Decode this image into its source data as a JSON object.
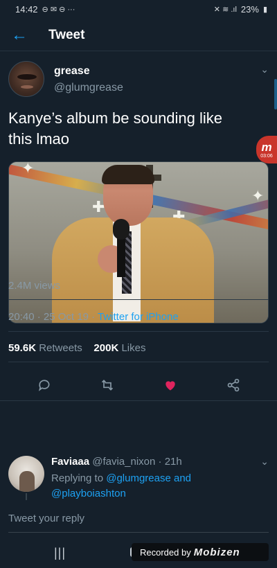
{
  "status_bar": {
    "time": "14:42",
    "battery": "23%"
  },
  "header": {
    "back_icon": "arrow-left-icon",
    "title": "Tweet"
  },
  "tweet": {
    "author_name": "grease",
    "author_handle": "@glumgrease",
    "text_line1": "Kanye’s album be sounding like",
    "text_line2": "this lmao",
    "views": "2.4M views",
    "time": "20:40",
    "date": "25 Oct 19",
    "source": "Twitter for iPhone",
    "retweets_count": "59.6K",
    "retweets_label": "Retweets",
    "likes_count": "200K",
    "likes_label": "Likes"
  },
  "actions": {
    "reply_icon": "comment-icon",
    "retweet_icon": "retweet-icon",
    "like_icon": "heart-icon",
    "share_icon": "share-icon",
    "like_color": "#e0245e"
  },
  "reply": {
    "author_name": "Faviaaa",
    "author_handle": "@favia_nixon",
    "time": "21h",
    "replying_to_label": "Replying to",
    "mention1": "@glumgrease",
    "and_label": "and",
    "mention2": "@playboiashton"
  },
  "compose": {
    "placeholder": "Tweet your reply"
  },
  "overlay": {
    "side_badge_letter": "m",
    "side_badge_time": "03:06",
    "recorded_label": "Recorded by",
    "brand": "Mobizen"
  },
  "colors": {
    "background": "#15202b",
    "accent": "#1da1f2",
    "muted": "#8899a6"
  }
}
